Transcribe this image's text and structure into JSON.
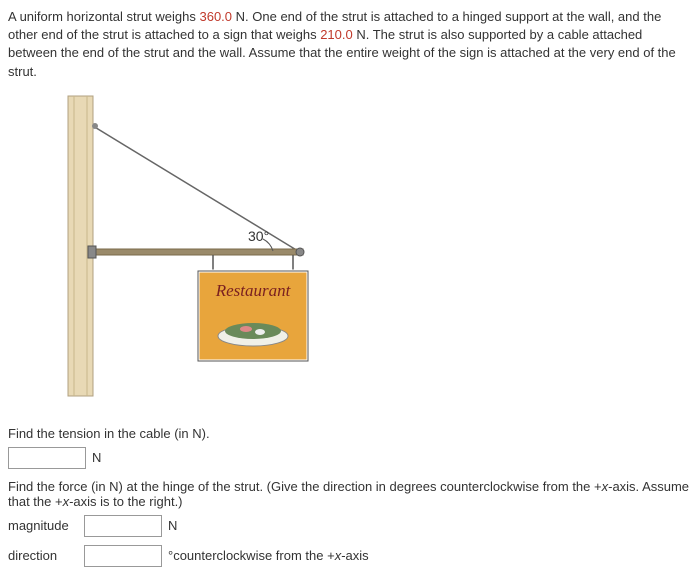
{
  "problem": {
    "part1": "A uniform horizontal strut weighs ",
    "weight1": "360.0",
    "part2": " N. One end of the strut is attached to a hinged support at the wall, and the other end of the strut is attached to a sign that weighs ",
    "weight2": "210.0",
    "part3": " N. The strut is also supported by a cable attached between the end of the strut and the wall. Assume that the entire weight of the sign is attached at the very end of the strut."
  },
  "figure": {
    "angle": "30°",
    "sign_text": "Restaurant"
  },
  "q1": {
    "text": "Find the tension in the cable (in N).",
    "unit": "N"
  },
  "q2": {
    "intro": "Find the force (in N) at the hinge of the strut. (Give the direction in degrees counterclockwise from the +",
    "axis1": "x",
    "mid": "-axis. Assume that the +",
    "axis2": "x",
    "end": "-axis is to the right.)",
    "magnitude_label": "magnitude",
    "magnitude_unit": "N",
    "direction_label": "direction",
    "direction_unit_pre": "°counterclockwise from the +",
    "direction_unit_axis": "x",
    "direction_unit_post": "-axis"
  }
}
